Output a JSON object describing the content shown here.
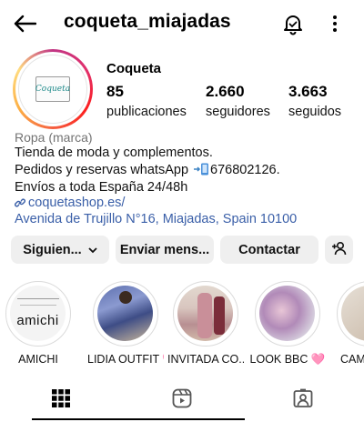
{
  "header": {
    "username": "coqueta_miajadas",
    "icons": [
      "back-arrow-icon",
      "bell-icon",
      "more-vertical-icon"
    ]
  },
  "profile": {
    "name": "Coqueta",
    "avatar_text": "Coqueta",
    "stats": [
      {
        "value": "85",
        "label": "publicaciones"
      },
      {
        "value": "2.660",
        "label": "seguidores"
      },
      {
        "value": "3.663",
        "label": "seguidos"
      }
    ],
    "category": "Ropa (marca)",
    "bio": {
      "line1": "Tienda de moda y complementos.",
      "line2_pre": "Pedidos y reservas whatsApp ",
      "line2_post": "676802126.",
      "line3": "Envíos a toda España 24/48h"
    },
    "website": "coquetashop.es/",
    "address": "Avenida de Trujillo N°16, Miajadas, Spain 10100"
  },
  "buttons": {
    "following": "Siguien...",
    "message": "Enviar mens...",
    "contact": "Contactar"
  },
  "highlights": [
    {
      "label": "AMICHI",
      "cover_text": "amichi"
    },
    {
      "label": "LIDIA OUTFIT 🩷"
    },
    {
      "label": "INVITADA CO..."
    },
    {
      "label": "LOOK BBC 🩷"
    },
    {
      "label": "CAM"
    }
  ],
  "tabs": [
    "grid-icon",
    "reels-icon",
    "tagged-icon"
  ],
  "colors": {
    "link": "#3a5fa8",
    "button_bg": "#efefef",
    "category": "#737373"
  }
}
